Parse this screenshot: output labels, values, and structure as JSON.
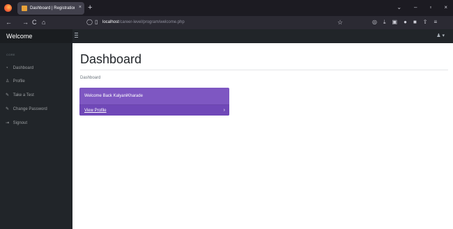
{
  "browser": {
    "tab_title": "Dashboard | Registration and L",
    "tab_close": "×",
    "new_tab": "+",
    "window_controls": [
      "⌄",
      "–",
      "▫",
      "×"
    ],
    "nav": {
      "back": "←",
      "forward": "→",
      "reload": "C",
      "home": "⌂"
    },
    "url_host": "localhost",
    "url_path": "/career-level/program/welcome.php",
    "icons": [
      "shield-icon",
      "page-icon",
      "star-icon",
      "pocket-icon",
      "download-icon",
      "library-icon",
      "account-icon",
      "extension-icon",
      "share-icon",
      "menu-icon"
    ]
  },
  "app": {
    "brand": "Welcome",
    "user_menu": "▾"
  },
  "sidebar": {
    "heading": "Core",
    "items": [
      {
        "icon": "◔",
        "label": "Dashboard"
      },
      {
        "icon": "♙",
        "label": "Profile"
      },
      {
        "icon": "✎",
        "label": "Take a Test"
      },
      {
        "icon": "✎",
        "label": "Change Password"
      },
      {
        "icon": "⇥",
        "label": "Signout"
      }
    ]
  },
  "main": {
    "title": "Dashboard",
    "breadcrumb": "Dashboard",
    "card": {
      "text": "Welcome Back KalyaniKharade",
      "link": "View Profile",
      "arrow": "›"
    }
  },
  "colors": {
    "sidebar_bg": "#212529",
    "card_bg": "#7e57c2",
    "browser_bg": "#1c1b22"
  }
}
